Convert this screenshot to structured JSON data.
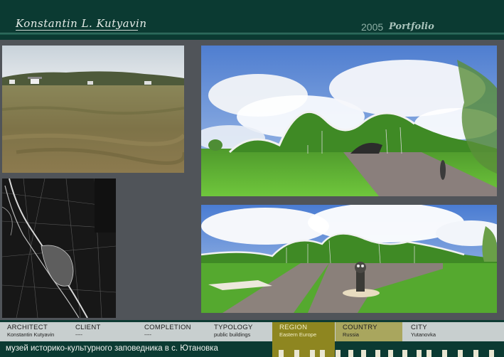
{
  "header": {
    "architect_name": "Konstantin L. Kutyavin",
    "year": "2005",
    "portfolio_label": "Portfolio"
  },
  "info": {
    "architect": {
      "label": "ARCHITECT",
      "value": "Konstantin Kutyavin"
    },
    "client": {
      "label": "CLIENT",
      "value": "----"
    },
    "completion": {
      "label": "COMPLETION",
      "value": "----"
    },
    "typology": {
      "label": "TYPOLOGY",
      "value": "public buildings"
    },
    "region": {
      "label": "REGION",
      "value": "Eastern Europe"
    },
    "country": {
      "label": "COUNTRY",
      "value": "Russia"
    },
    "city": {
      "label": "CITY",
      "value": "Yutanovka"
    }
  },
  "footer": {
    "project_title": "музей историко-культурного заповедника в с. Ютановка"
  },
  "colors": {
    "header_bg": "#0b3a32",
    "panel_bg": "#505459",
    "region_accent": "#8e8620",
    "country_accent": "#a9a65e"
  }
}
